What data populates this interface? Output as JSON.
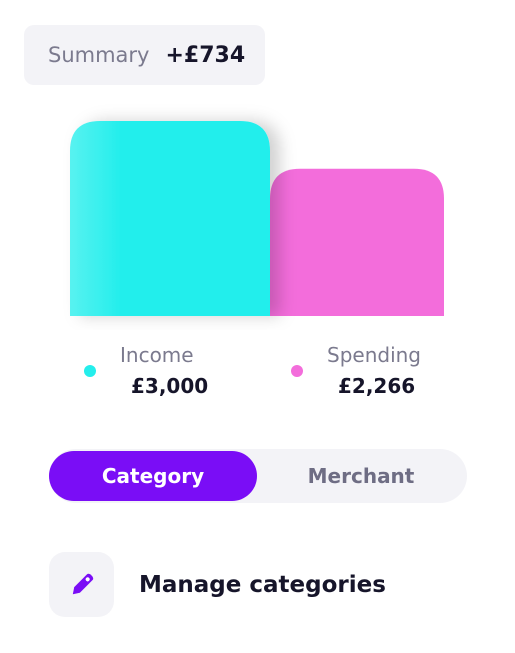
{
  "summary": {
    "label": "Summary",
    "value": "+£734"
  },
  "chart_data": {
    "type": "bar",
    "categories": [
      "Income",
      "Spending"
    ],
    "values": [
      3000,
      2266
    ],
    "colors": [
      "#24eeec",
      "#f36ddb"
    ],
    "ylim": [
      0,
      3000
    ]
  },
  "legend": [
    {
      "label": "Income",
      "value": "£3,000",
      "color": "#24eeec"
    },
    {
      "label": "Spending",
      "value": "£2,266",
      "color": "#f36ddb"
    }
  ],
  "toggle": {
    "active": "Category",
    "inactive": "Merchant"
  },
  "manage": {
    "label": "Manage categories",
    "icon": "tag-icon"
  },
  "colors": {
    "accent": "#7a0df6",
    "surface": "#f3f3f7"
  }
}
